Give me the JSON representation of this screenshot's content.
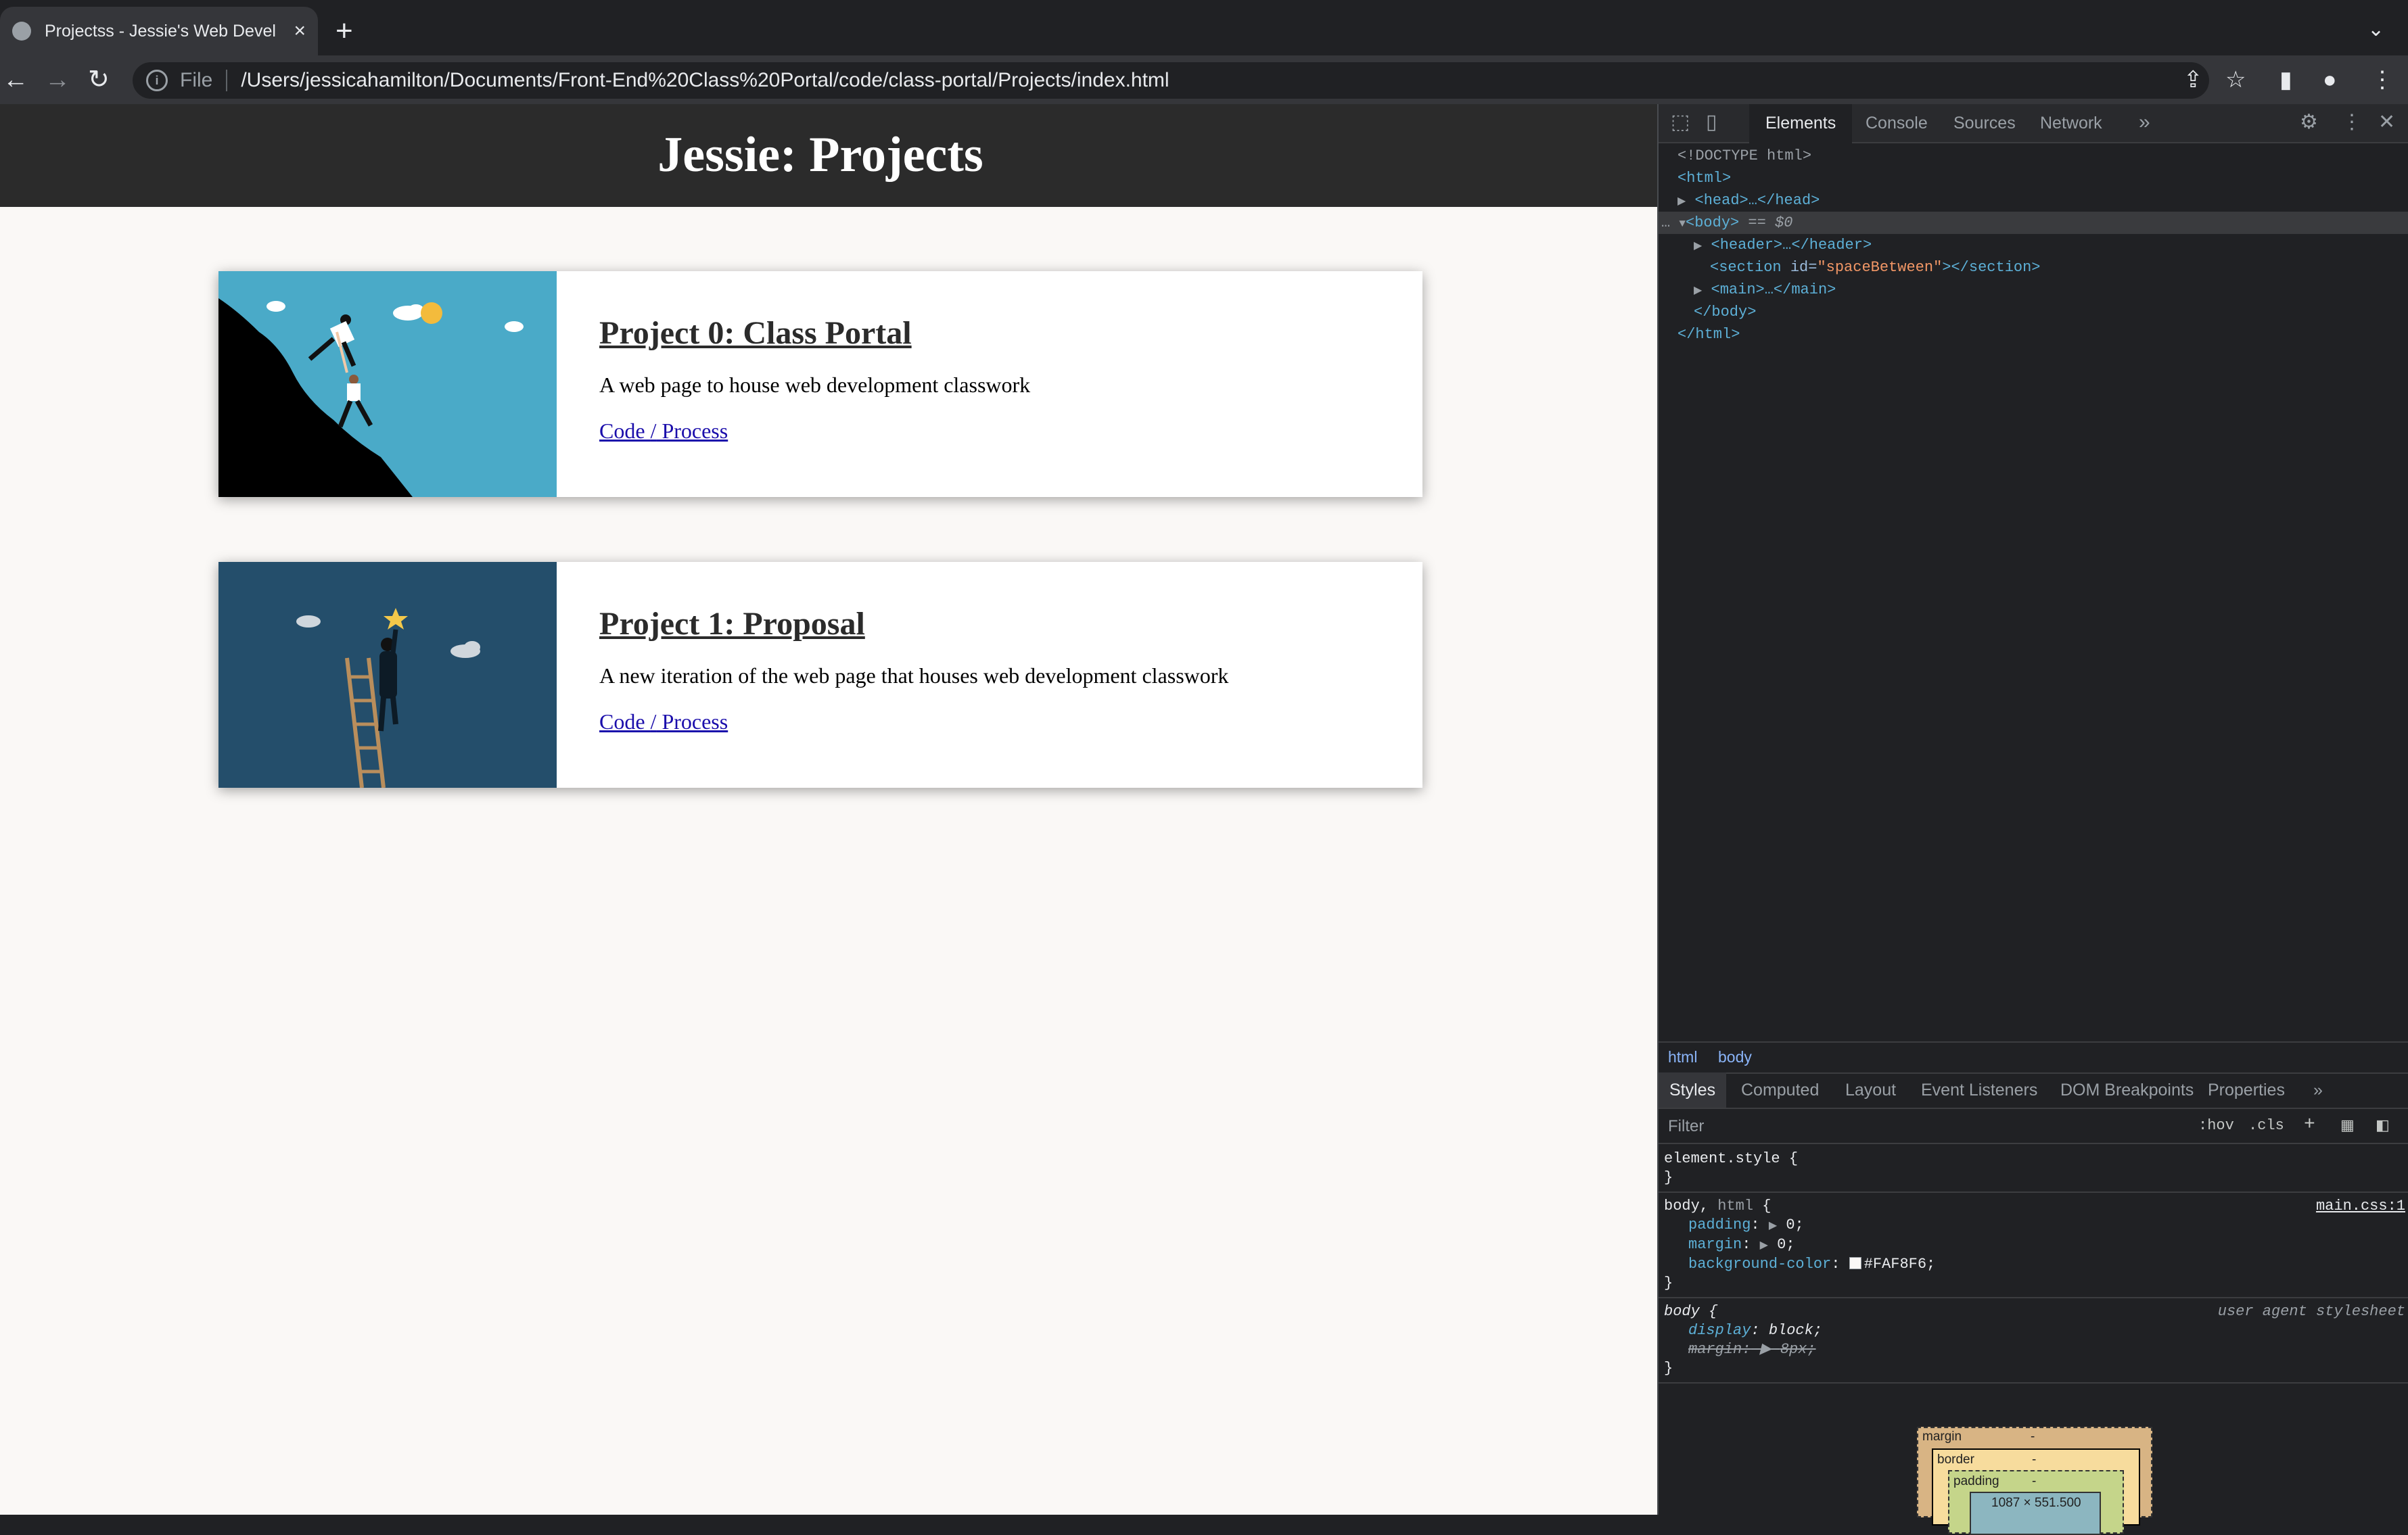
{
  "browser": {
    "tab_title": "Projectss - Jessie's Web Devel",
    "tab_close": "×",
    "new_tab": "+",
    "tab_search": "⌄",
    "back": "←",
    "forward": "→",
    "reload": "↻",
    "info": "i",
    "file_label": "File",
    "url": "/Users/jessicahamilton/Documents/Front-End%20Class%20Portal/code/class-portal/Projects/index.html",
    "share_icon": "⇪",
    "star_icon": "☆",
    "sidepanel_icon": "▮",
    "profile_icon": "●",
    "menu_icon": "⋮"
  },
  "page": {
    "header_title": "Jessie: Projects",
    "background": "#FAF8F6",
    "header_bg": "#2b2b2b",
    "projects": [
      {
        "title": "Project 0: Class Portal",
        "description": "A web page to house web development classwork",
        "code_label": "Code ",
        "separator": "/",
        "process_label": " Process",
        "image_bg": "#4aaac8"
      },
      {
        "title": "Project 1: Proposal",
        "description": "A new iteration of the web page that houses web development classwork",
        "code_label": "Code ",
        "separator": "/",
        "process_label": " Process",
        "image_bg": "#244e6b"
      }
    ]
  },
  "devtools": {
    "tabs": [
      "Elements",
      "Console",
      "Sources",
      "Network"
    ],
    "more_tabs": "»",
    "settings_icon": "⚙",
    "menu_icon": "⋮",
    "close_icon": "✕",
    "dom": {
      "doctype": "<!DOCTYPE html>",
      "html_open": "<html>",
      "head": "<head>…</head>",
      "body_open": "<body>",
      "body_sel": " == $0",
      "header": "<header>…</header>",
      "section_tag": "<section",
      "section_attr": " id=",
      "section_val": "\"spaceBetween\"",
      "section_close": "></section>",
      "main": "<main>…</main>",
      "body_close": "</body>",
      "html_close": "</html>",
      "dots": "…"
    },
    "breadcrumbs": [
      "html",
      "body"
    ],
    "styles_tabs": [
      "Styles",
      "Computed",
      "Layout",
      "Event Listeners",
      "DOM Breakpoints",
      "Properties"
    ],
    "filter_placeholder": "Filter",
    "hov": ":hov",
    "cls": ".cls",
    "plus": "+",
    "rules": {
      "element_style": "element.style {",
      "close_brace": "}",
      "body_html_selector": "body, ",
      "body_html_selector_dim": "html",
      "body_html_open": " {",
      "main_css": "main.css:1",
      "padding_prop": "padding",
      "padding_val": "0;",
      "margin_prop": "margin",
      "margin_val": "0;",
      "bg_prop": "background-color",
      "bg_val": "#FAF8F6;",
      "body_selector": "body {",
      "ua_label": "user agent stylesheet",
      "display_prop": "display",
      "display_val": "block;",
      "margin_ua_prop": "margin:",
      "margin_ua_val": "8px;"
    },
    "box_model": {
      "margin_label": "margin",
      "margin_val": "-",
      "border_label": "border",
      "border_val": "-",
      "padding_label": "padding",
      "padding_val": "-",
      "content_val": "1087 × 551.500"
    }
  }
}
